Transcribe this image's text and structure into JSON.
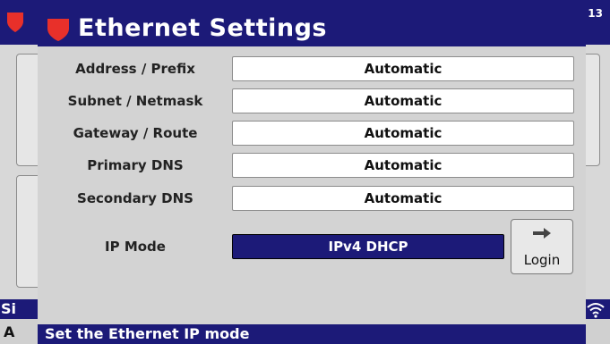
{
  "background": {
    "corner_number": "13",
    "bottom_bar_text": "Si",
    "status_text": "A"
  },
  "dialog": {
    "title": "Ethernet Settings",
    "rows": [
      {
        "label": "Address / Prefix",
        "value": "Automatic"
      },
      {
        "label": "Subnet / Netmask",
        "value": "Automatic"
      },
      {
        "label": "Gateway / Route",
        "value": "Automatic"
      },
      {
        "label": "Primary DNS",
        "value": "Automatic"
      },
      {
        "label": "Secondary DNS",
        "value": "Automatic"
      }
    ],
    "ip_mode": {
      "label": "IP Mode",
      "value": "IPv4 DHCP"
    },
    "login_label": "Login",
    "footer": "Set the Ethernet IP mode"
  },
  "colors": {
    "title_bar": "#1c1a78",
    "shield_red": "#e8302a",
    "field_white": "#ffffff"
  },
  "icons": {
    "shield": "shield-icon",
    "arrow": "arrow-right-icon",
    "wifi": "wifi-icon"
  }
}
